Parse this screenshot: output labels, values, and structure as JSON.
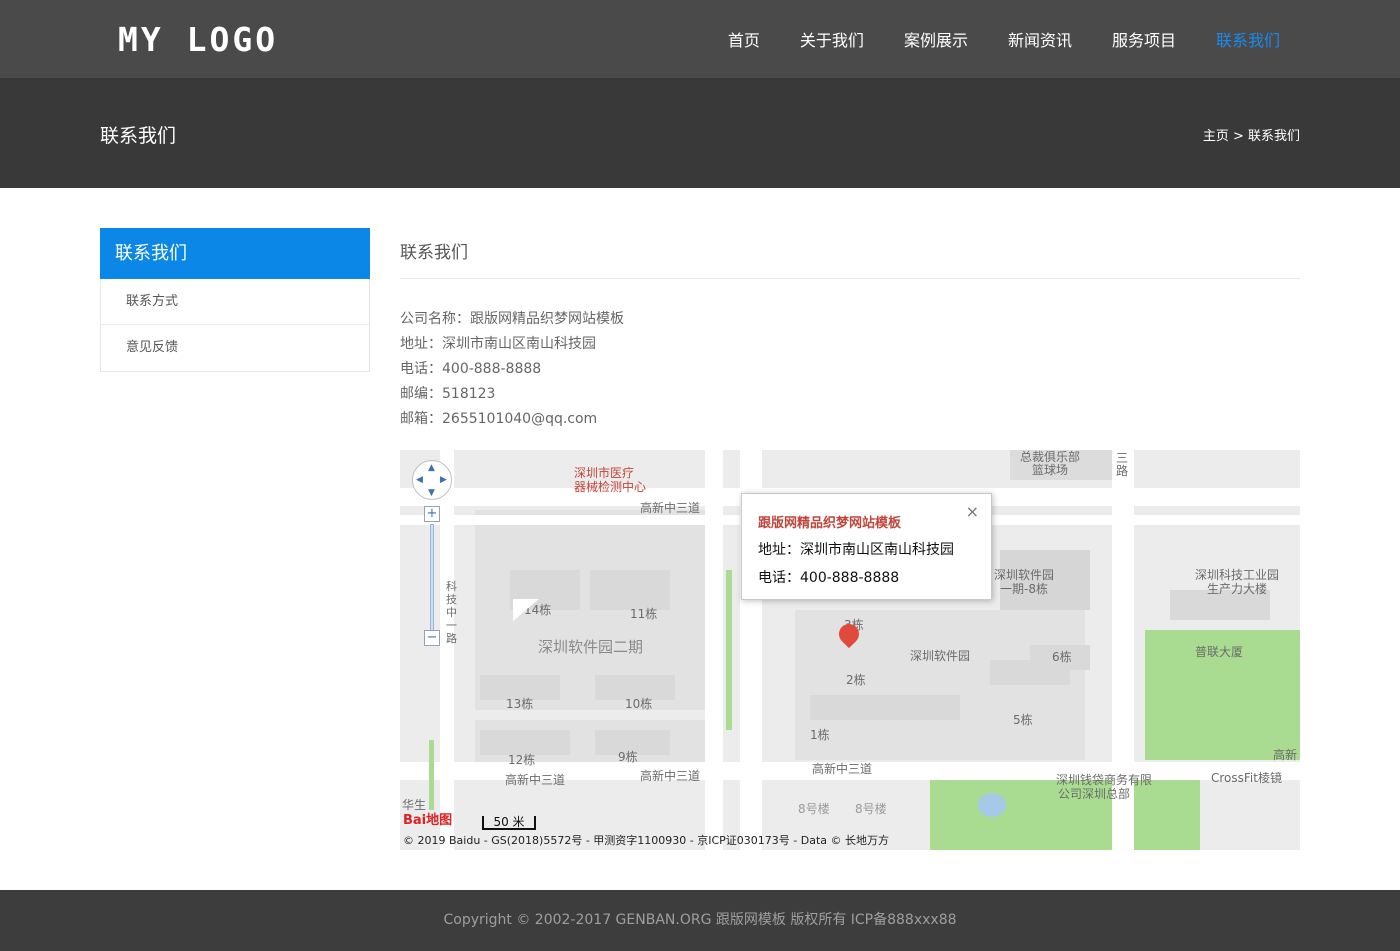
{
  "header": {
    "logo": "MY LOGO",
    "nav": [
      {
        "label": "首页"
      },
      {
        "label": "关于我们"
      },
      {
        "label": "案例展示"
      },
      {
        "label": "新闻资讯"
      },
      {
        "label": "服务项目"
      },
      {
        "label": "联系我们"
      }
    ],
    "active_color": "#1a8bea"
  },
  "banner": {
    "title": "联系我们",
    "breadcrumb": "主页 > 联系我们"
  },
  "sidebar": {
    "title": "联系我们",
    "items": [
      {
        "label": "联系方式"
      },
      {
        "label": "意见反馈"
      }
    ],
    "accent": "#0b87e8"
  },
  "main": {
    "title": "联系我们",
    "info": [
      "公司名称：跟版网精品织梦网站模板",
      "地址：深圳市南山区南山科技园",
      "电话：400-888-8888",
      "邮编：518123",
      "邮箱：2655101040@qq.com"
    ]
  },
  "map": {
    "popup": {
      "title": "跟版网精品织梦网站模板",
      "address": "地址：深圳市南山区南山科技园",
      "phone": "电话：400-888-8888",
      "close": "×"
    },
    "labels": {
      "l1": "深圳市医疗",
      "l2": "器械检测中心",
      "l3": "高新中三道",
      "l4": "总裁俱乐部",
      "l5": "篮球场",
      "l6": "14栋",
      "l7": "11栋",
      "l8": "深圳软件园二期",
      "l9": "13栋",
      "l10": "10栋",
      "l11": "12栋",
      "l12": "9栋",
      "l13": "高新中三道",
      "l14": "高新中三道",
      "l15": "3栋",
      "l16": "2栋",
      "l17": "深圳软件园",
      "l18": "1栋",
      "l19": "深圳软件园",
      "l20": "一期-8栋",
      "l21": "6栋",
      "l22": "5栋",
      "l23": "深圳科技工业园",
      "l24": "生产力大楼",
      "l25": "普联大厦",
      "l26": "高新",
      "l27": "CrossFit棱镜",
      "l28": "深圳钱袋商务有限",
      "l29": "公司深圳总部",
      "l30": "高新中三道",
      "l31": "科技中一路",
      "l32": "三路",
      "l33": "华生",
      "l34": "8号楼",
      "l35": "8号楼"
    },
    "brand": "Bai地图",
    "scale": "50 米",
    "copyright": "© 2019 Baidu - GS(2018)5572号 - 甲测资字1100930 - 京ICP证030173号 - Data © 长地万方"
  },
  "footer": {
    "text": "Copyright © 2002-2017 GENBAN.ORG 跟版网模板 版权所有 ICP备888xxx88"
  }
}
